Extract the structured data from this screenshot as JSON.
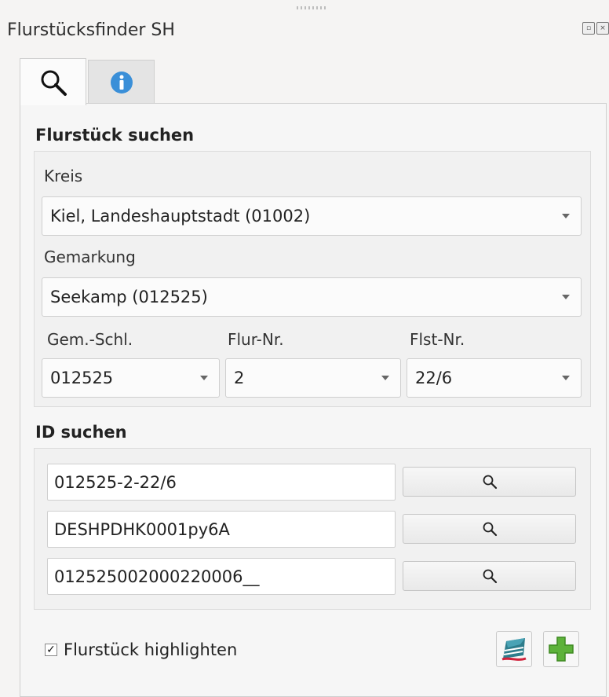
{
  "window": {
    "title": "Flurstücksfinder SH"
  },
  "tabs": [
    {
      "icon": "search-icon"
    },
    {
      "icon": "info-icon"
    }
  ],
  "search_section": {
    "heading": "Flurstück suchen",
    "kreis": {
      "label": "Kreis",
      "value": "Kiel, Landeshauptstadt (01002)"
    },
    "gemarkung": {
      "label": "Gemarkung",
      "value": "Seekamp (012525)"
    },
    "gem_schl": {
      "label": "Gem.-Schl.",
      "value": "012525"
    },
    "flur_nr": {
      "label": "Flur-Nr.",
      "value": "2"
    },
    "flst_nr": {
      "label": "Flst-Nr.",
      "value": "22/6"
    }
  },
  "id_section": {
    "heading": "ID suchen",
    "fields": [
      {
        "value": "012525-2-22/6"
      },
      {
        "value": "DESHPDHK0001py6A"
      },
      {
        "value": "012525002000220006__"
      }
    ]
  },
  "options": {
    "highlight_label": "Flurstück highlighten",
    "highlight_checked": "✓"
  },
  "colors": {
    "info_blue": "#3a8fd8",
    "plus_green": "#5db23a"
  }
}
